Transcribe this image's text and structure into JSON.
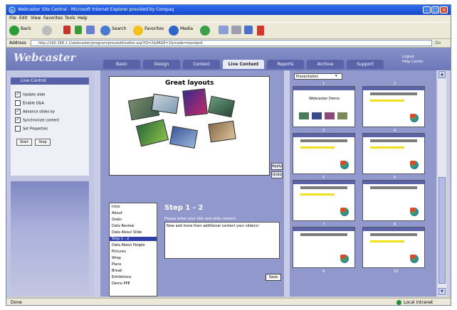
{
  "window": {
    "title": "Webcaster Site Central - Microsoft Internet Explorer provided by Compaq"
  },
  "menu": [
    "File",
    "Edit",
    "View",
    "Favorites",
    "Tools",
    "Help"
  ],
  "toolbar": {
    "back": "Back",
    "search": "Search",
    "favorites": "Favorites",
    "media": "Media"
  },
  "address": {
    "label": "Address",
    "value": "http://192.168.1.1/webcaster/program/pres/edit/editor.asp?ID=2&PAGE=1&mode=standard",
    "go": "Go"
  },
  "site": {
    "logo": "Webcaster",
    "toplinks": [
      "Logout",
      "Help Center"
    ],
    "tabs": [
      "Basic",
      "Design",
      "Content",
      "Live Content",
      "Reports",
      "Archive",
      "Support"
    ]
  },
  "left_panel": {
    "header": "Live Control",
    "options": [
      {
        "label": "Update slide",
        "checked": true
      },
      {
        "label": "Enable Q&A",
        "checked": false
      },
      {
        "label": "Advance slides by",
        "checked": true
      },
      {
        "label": "Synchronize content",
        "checked": true
      },
      {
        "label": "Set Properties",
        "checked": false
      }
    ],
    "buttons": [
      "Start",
      "Stop"
    ]
  },
  "preview": {
    "title": "Great layouts",
    "side_buttons": [
      "Apply",
      "Undo"
    ]
  },
  "steps_list": {
    "items": [
      "Intro",
      "About",
      "Goals",
      "Data Review",
      "Data About Slide",
      "Step 1 - 2",
      "Data About People",
      "Pictures",
      "Wrap",
      "Plans",
      "Break",
      "Exhibitions",
      "Demo PPE"
    ],
    "selected_index": 5
  },
  "step_detail": {
    "title": "Step 1 - 2",
    "label": "Please enter your title and slide content",
    "text": "Now add more then additional content your slide(s)",
    "save": "Save"
  },
  "slides_panel": {
    "select_value": "Presentation",
    "numbers": [
      "1",
      "2",
      "3",
      "4",
      "5",
      "6",
      "7",
      "8",
      "9",
      "10"
    ],
    "first_slide_title": "Webcaster Demo"
  },
  "statusbar": {
    "left": "Done",
    "right": "Local intranet"
  }
}
